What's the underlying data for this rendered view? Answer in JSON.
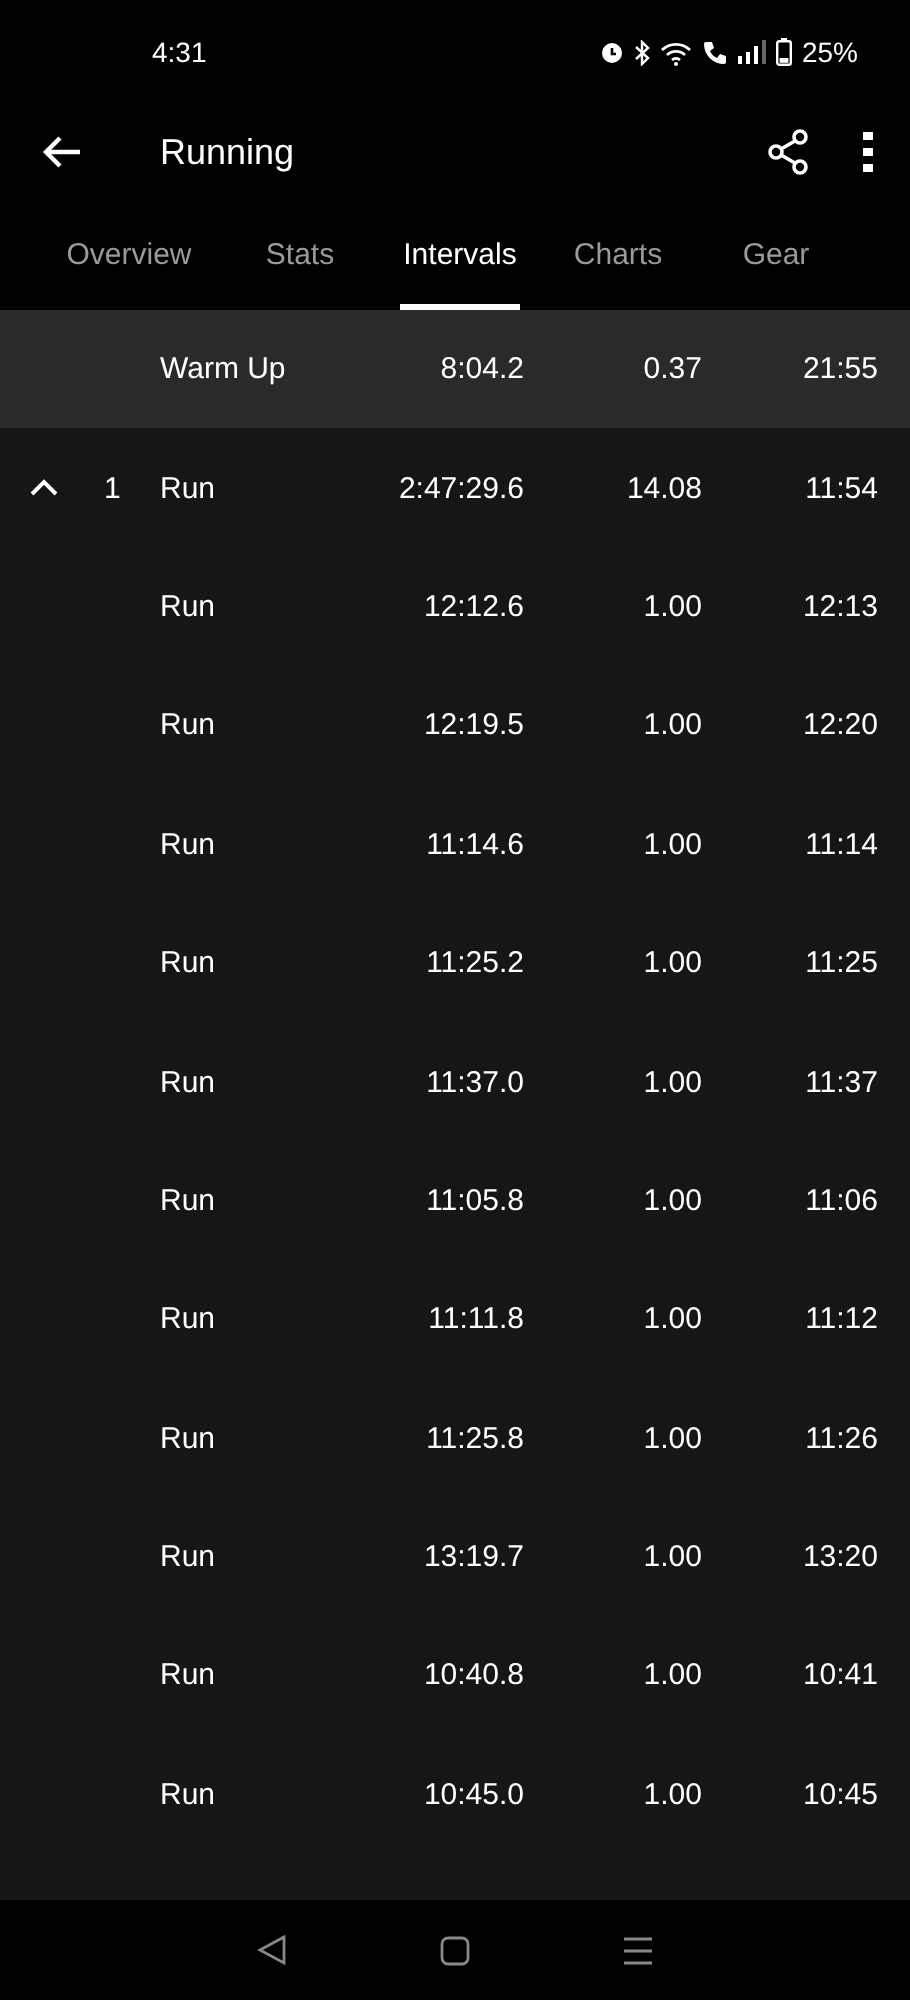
{
  "status_bar": {
    "time": "4:31",
    "battery": "25%"
  },
  "app_bar": {
    "title": "Running"
  },
  "tabs": [
    {
      "label": "Overview",
      "selected": false
    },
    {
      "label": "Stats",
      "selected": false
    },
    {
      "label": "Intervals",
      "selected": true
    },
    {
      "label": "Charts",
      "selected": false
    },
    {
      "label": "Gear",
      "selected": false
    }
  ],
  "intervals": [
    {
      "kind": "warmup",
      "name": "Warm Up",
      "time": "8:04.2",
      "distance": "0.37",
      "pace": "21:55"
    },
    {
      "kind": "group",
      "expanded": true,
      "index": "1",
      "name": "Run",
      "time": "2:47:29.6",
      "distance": "14.08",
      "pace": "11:54"
    },
    {
      "kind": "lap",
      "name": "Run",
      "time": "12:12.6",
      "distance": "1.00",
      "pace": "12:13"
    },
    {
      "kind": "lap",
      "name": "Run",
      "time": "12:19.5",
      "distance": "1.00",
      "pace": "12:20"
    },
    {
      "kind": "lap",
      "name": "Run",
      "time": "11:14.6",
      "distance": "1.00",
      "pace": "11:14"
    },
    {
      "kind": "lap",
      "name": "Run",
      "time": "11:25.2",
      "distance": "1.00",
      "pace": "11:25"
    },
    {
      "kind": "lap",
      "name": "Run",
      "time": "11:37.0",
      "distance": "1.00",
      "pace": "11:37"
    },
    {
      "kind": "lap",
      "name": "Run",
      "time": "11:05.8",
      "distance": "1.00",
      "pace": "11:06"
    },
    {
      "kind": "lap",
      "name": "Run",
      "time": "11:11.8",
      "distance": "1.00",
      "pace": "11:12"
    },
    {
      "kind": "lap",
      "name": "Run",
      "time": "11:25.8",
      "distance": "1.00",
      "pace": "11:26"
    },
    {
      "kind": "lap",
      "name": "Run",
      "time": "13:19.7",
      "distance": "1.00",
      "pace": "13:20"
    },
    {
      "kind": "lap",
      "name": "Run",
      "time": "10:40.8",
      "distance": "1.00",
      "pace": "10:41"
    },
    {
      "kind": "lap",
      "name": "Run",
      "time": "10:45.0",
      "distance": "1.00",
      "pace": "10:45"
    }
  ]
}
